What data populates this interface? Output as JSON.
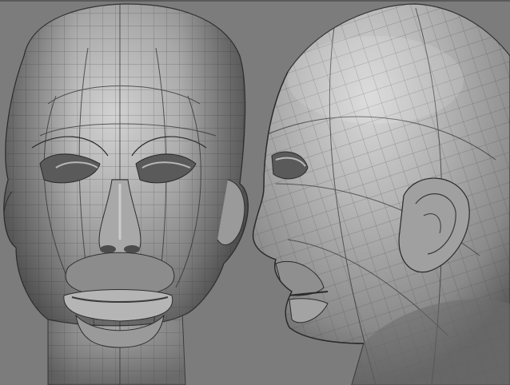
{
  "scene": {
    "background_color": "#7c7c7c",
    "mesh_color": "#3e3e3e",
    "highlight_color": "#cfcfcf",
    "shadow_color": "#4a4a4a",
    "views": [
      {
        "id": "front",
        "label": ""
      },
      {
        "id": "side",
        "label": ""
      }
    ]
  }
}
